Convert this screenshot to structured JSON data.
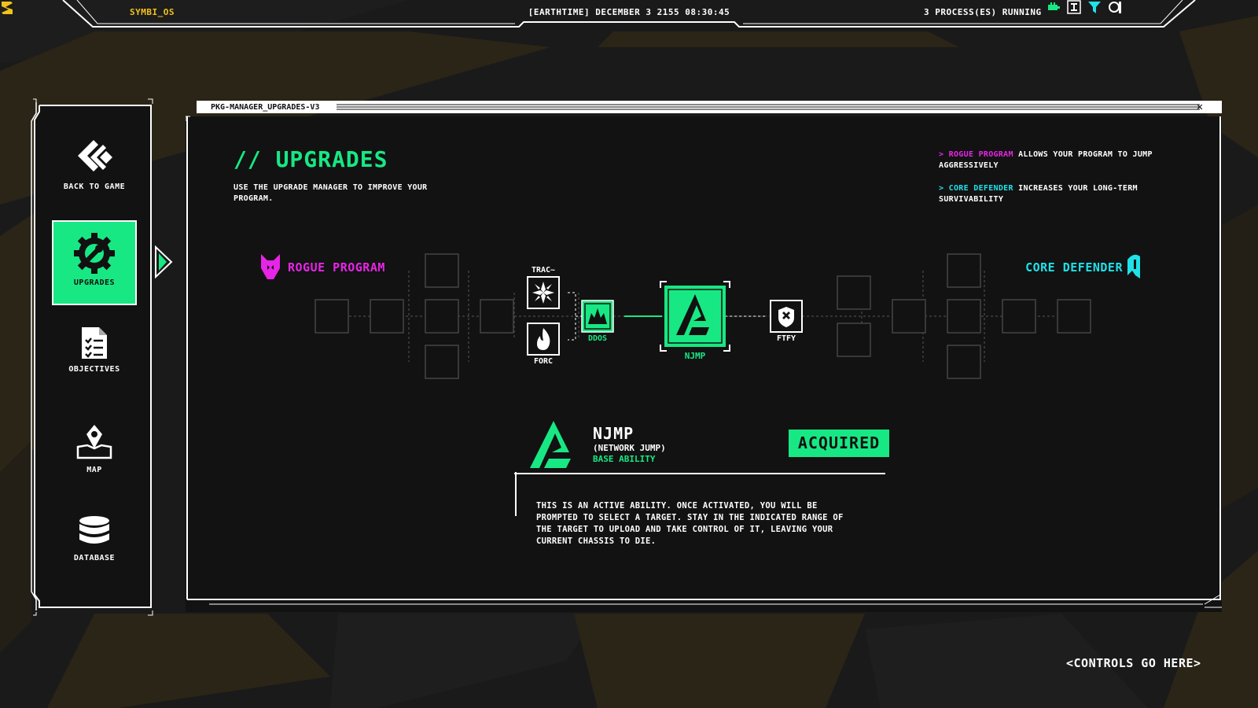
{
  "topbar": {
    "os_name": "SYMBI_OS",
    "clock": "[EARTHTIME] DECEMBER 3 2155 08:30:45",
    "processes": "3 PROCESS(ES) RUNNING",
    "tray_icons": [
      "battery-icon",
      "text-icon",
      "filter-icon",
      "signal-icon"
    ]
  },
  "sidebar": {
    "items": [
      {
        "label": "BACK TO GAME",
        "icon": "back-chevrons-icon"
      },
      {
        "label": "UPGRADES",
        "icon": "gear-wrench-icon",
        "active": true
      },
      {
        "label": "OBJECTIVES",
        "icon": "checklist-icon"
      },
      {
        "label": "MAP",
        "icon": "map-pin-icon"
      },
      {
        "label": "DATABASE",
        "icon": "database-icon"
      }
    ]
  },
  "panel": {
    "window_title": "PKG-MANAGER_UPGRADES-V3",
    "close": "✕",
    "heading": "// UPGRADES",
    "subheading": "USE THE UPGRADE MANAGER TO IMPROVE YOUR PROGRAM.",
    "tips": [
      {
        "prefix": ">",
        "highlight": "ROGUE PROGRAM",
        "text": " ALLOWS YOUR PROGRAM TO JUMP AGGRESSIVELY"
      },
      {
        "prefix": ">",
        "highlight": "CORE DEFENDER",
        "text": " INCREASES YOUR LONG-TERM SURVIVABILITY"
      }
    ]
  },
  "tree": {
    "left_branch": "ROGUE PROGRAM",
    "right_branch": "CORE DEFENDER",
    "nodes": {
      "trac": "TRAC~",
      "forc": "FORC",
      "ddos": "DDOS",
      "njmp": "NJMP",
      "ftfy": "FTFY"
    }
  },
  "detail": {
    "name": "NJMP",
    "full_name": "(NETWORK JUMP)",
    "type": "BASE ABILITY",
    "status": "ACQUIRED",
    "description": "THIS IS AN ACTIVE ABILITY. ONCE ACTIVATED, YOU WILL BE PROMPTED TO SELECT A TARGET. STAY IN THE INDICATED RANGE OF THE TARGET TO UPLOAD AND TAKE CONTROL OF IT, LEAVING YOUR CURRENT CHASSIS TO DIE."
  },
  "footer": {
    "controls": "<CONTROLS GO HERE>"
  },
  "colors": {
    "accent_green": "#17e883",
    "rogue_pink": "#e625e6",
    "defender_cyan": "#1fe1e8",
    "os_yellow": "#f2c21a",
    "background": "#1a1a1a"
  }
}
